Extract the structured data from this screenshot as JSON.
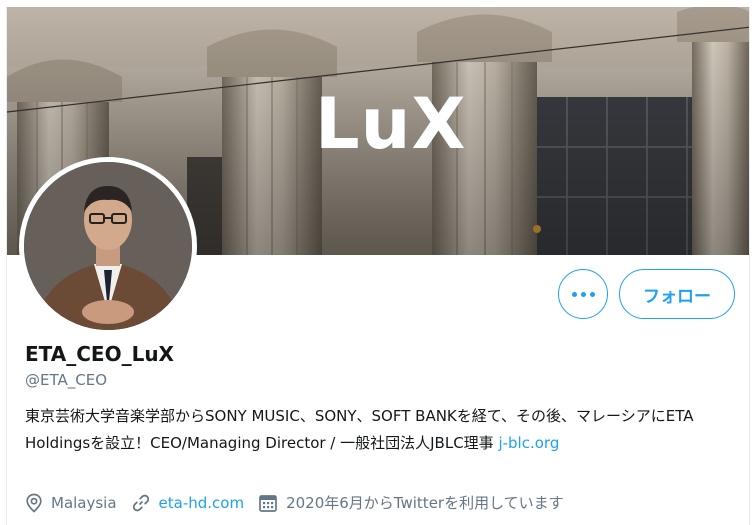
{
  "banner": {
    "text": "LuX"
  },
  "actions": {
    "more_label": "•••",
    "follow_label": "フォロー"
  },
  "profile": {
    "display_name": "ETA_CEO_LuX",
    "handle": "@ETA_CEO",
    "bio_text": "東京芸術大学音楽学部からSONY MUSIC、SONY、SOFT BANKを経て、その後、マレーシアにETA Holdingsを設立！CEO/Managing  Director / 一般社団法人JBLC理事 ",
    "bio_link": "j-blc.org",
    "location": "Malaysia",
    "website": "eta-hd.com",
    "joined": "2020年6月からTwitterを利用しています"
  },
  "icons": [
    "location-icon",
    "link-icon",
    "calendar-icon",
    "more-icon"
  ],
  "colors": {
    "accent": "#1da1f2",
    "secondary_text": "#657786",
    "primary_text": "#14171a"
  }
}
